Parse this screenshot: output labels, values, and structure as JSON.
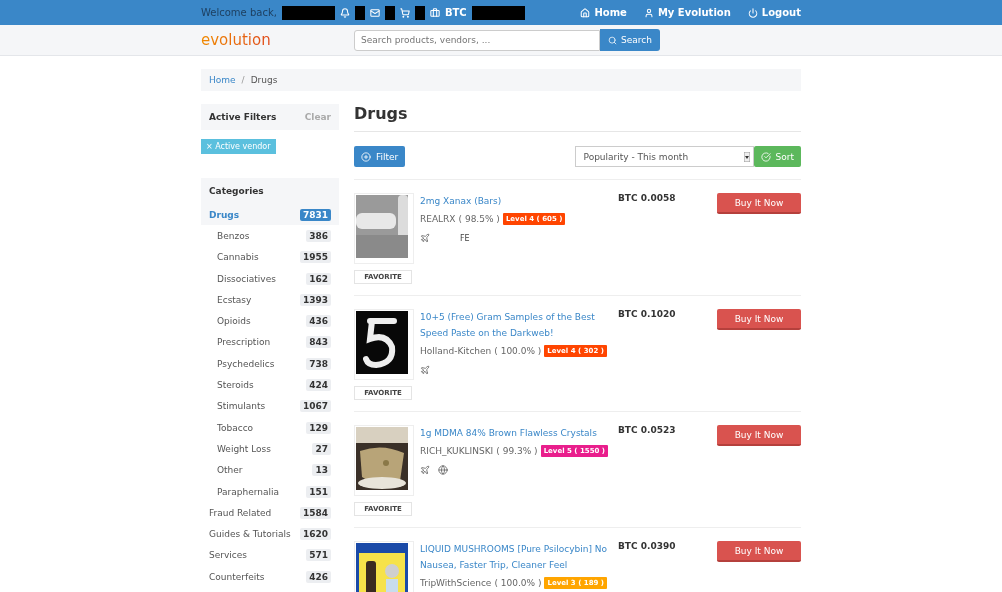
{
  "topbar": {
    "left": [
      {
        "kind": "text",
        "label": "Welcome back,"
      },
      {
        "kind": "redactionwide"
      },
      {
        "kind": "bell"
      },
      {
        "kind": "redactionsmall"
      },
      {
        "kind": "mail"
      },
      {
        "kind": "redactionsmall"
      },
      {
        "kind": "cart"
      },
      {
        "kind": "redactionsmall"
      },
      {
        "kind": "wallet",
        "label": "BTC"
      },
      {
        "kind": "redactionwide"
      }
    ],
    "right": [
      {
        "kind": "home",
        "label": "Home"
      },
      {
        "kind": "user",
        "label": "My Evolution"
      },
      {
        "kind": "power",
        "label": "Logout"
      }
    ]
  },
  "header": {
    "logo": "evolution",
    "search": {
      "placeholder": "Search products, vendors, ..."
    },
    "search_button": "Search"
  },
  "breadcrumb": [
    {
      "kind": "item",
      "label": "Home",
      "link": true
    },
    {
      "kind": "separator",
      "label": "/"
    },
    {
      "kind": "item",
      "label": "Drugs",
      "link": false
    }
  ],
  "sidebar": {
    "filters_title": "Active Filters",
    "clear": "Clear",
    "filters": [
      "× Active vendor"
    ],
    "categories_title": "Categories",
    "categories": [
      {
        "label": "Drugs",
        "count": "7831",
        "selected": true,
        "children": [
          {
            "label": "Benzos",
            "count": "386",
            "selected": false
          },
          {
            "label": "Cannabis",
            "count": "1955",
            "selected": false
          },
          {
            "label": "Dissociatives",
            "count": "162",
            "selected": false
          },
          {
            "label": "Ecstasy",
            "count": "1393",
            "selected": false
          },
          {
            "label": "Opioids",
            "count": "436",
            "selected": false
          },
          {
            "label": "Prescription",
            "count": "843",
            "selected": false
          },
          {
            "label": "Psychedelics",
            "count": "738",
            "selected": false
          },
          {
            "label": "Steroids",
            "count": "424",
            "selected": false
          },
          {
            "label": "Stimulants",
            "count": "1067",
            "selected": false
          },
          {
            "label": "Tobacco",
            "count": "129",
            "selected": false
          },
          {
            "label": "Weight Loss",
            "count": "27",
            "selected": false
          },
          {
            "label": "Other",
            "count": "13",
            "selected": false
          },
          {
            "label": "Paraphernalia",
            "count": "151",
            "selected": false
          }
        ]
      },
      {
        "label": "Fraud Related",
        "count": "1584",
        "selected": false
      },
      {
        "label": "Guides & Tutorials",
        "count": "1620",
        "selected": false
      },
      {
        "label": "Services",
        "count": "571",
        "selected": false
      },
      {
        "label": "Counterfeits",
        "count": "426",
        "selected": false
      }
    ]
  },
  "main": {
    "title": "Drugs",
    "filter_button": "Filter",
    "sort_select": "Popularity - This month",
    "sort_button": "Sort",
    "listings": [
      {
        "title": "2mg Xanax (Bars)",
        "vendor": "REALRX",
        "rating": "( 98.5% )",
        "level": "Level 4 ( 605 )",
        "color": "#ff4500",
        "price": "BTC 0.0058",
        "buy": "Buy It Now",
        "favorite": "FAVORITE",
        "ships": [
          {
            "kind": "plane"
          }
        ],
        "ships_text": "FE"
      },
      {
        "title": "10+5 (Free) Gram Samples of the Best Speed Paste on the Darkweb!",
        "vendor": "Holland-Kitchen",
        "rating": "( 100.0% )",
        "level": "Level 4 ( 302 )",
        "color": "#ff4500",
        "price": "BTC 0.1020",
        "buy": "Buy It Now",
        "favorite": "FAVORITE",
        "ships": [
          {
            "kind": "plane"
          }
        ]
      },
      {
        "title": "1g MDMA 84% Brown Flawless Crystals",
        "vendor": "RICH_KUKLINSKI",
        "rating": "( 99.3% )",
        "level": "Level 5 ( 1550 )",
        "color": "#e91e8c",
        "price": "BTC 0.0523",
        "buy": "Buy It Now",
        "favorite": "FAVORITE",
        "ships": [
          {
            "kind": "plane"
          },
          {
            "kind": "globe"
          }
        ]
      },
      {
        "title": "LIQUID MUSHROOMS [Pure Psilocybin] No Nausea, Faster Trip, Cleaner Feel",
        "vendor": "TripWithScience",
        "rating": "( 100.0% )",
        "level": "Level 3 ( 189 )",
        "color": "#ffa500",
        "price": "BTC 0.0390",
        "buy": "Buy It Now"
      }
    ]
  }
}
